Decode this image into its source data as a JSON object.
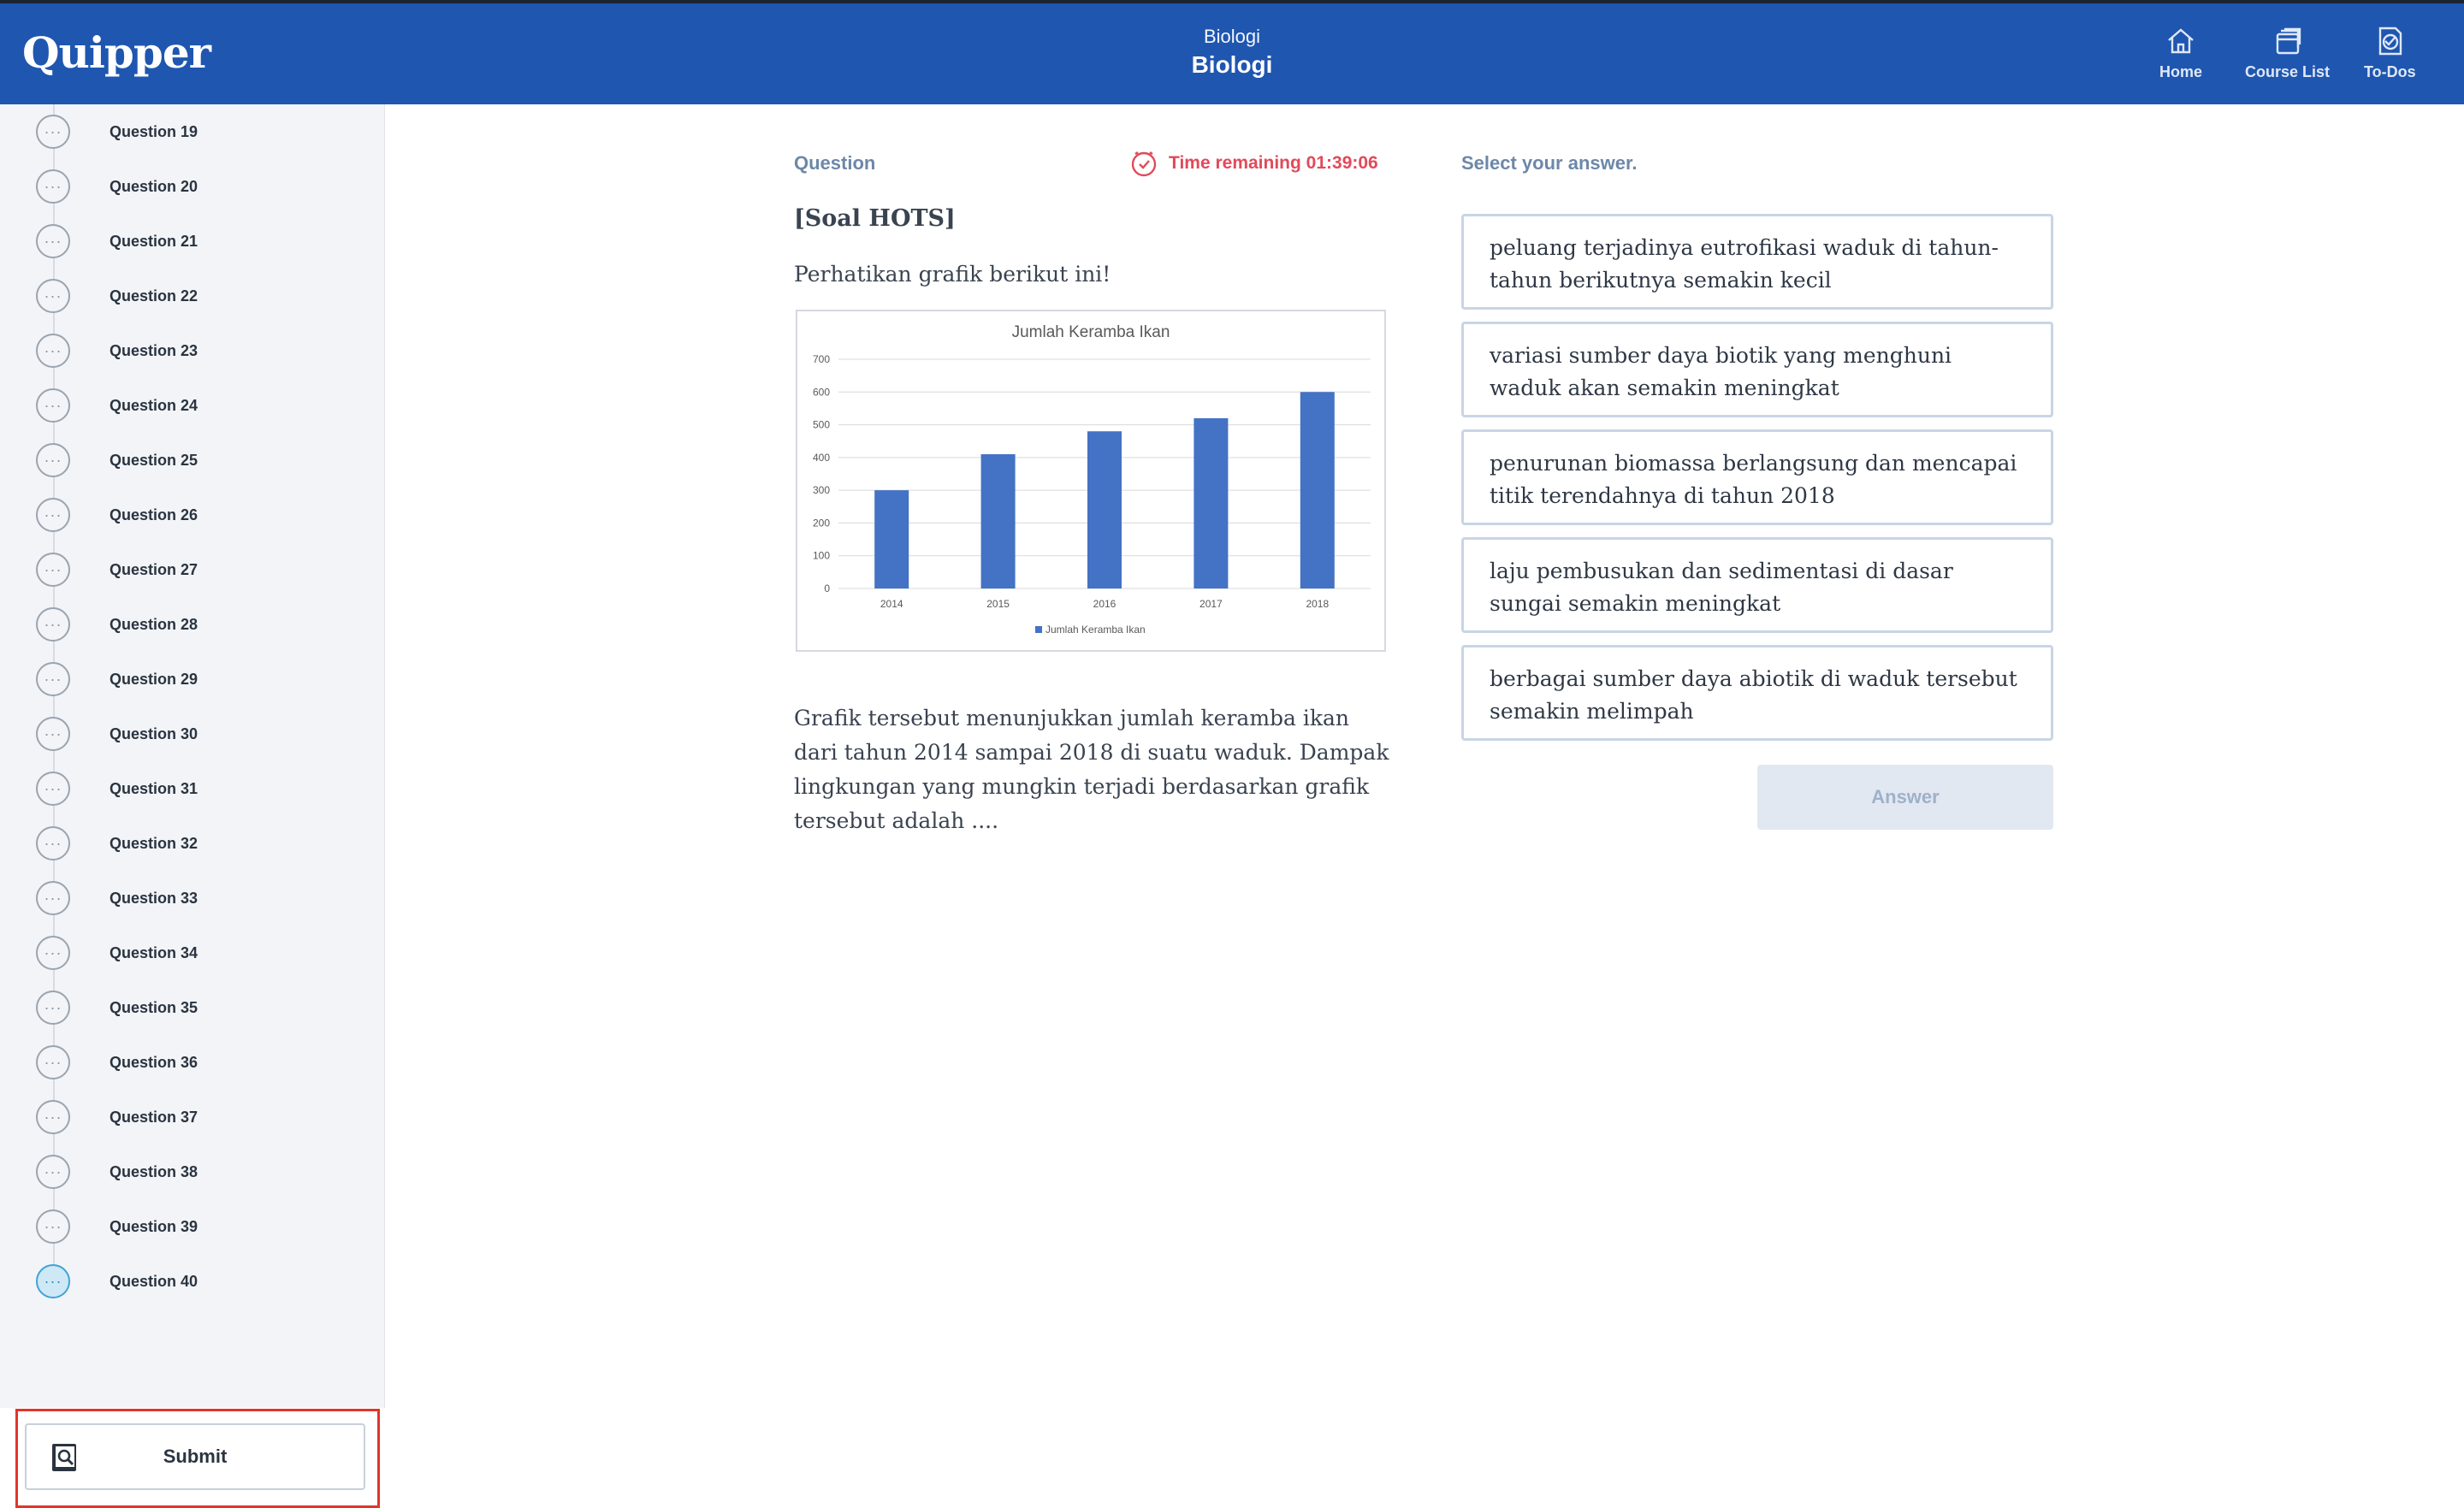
{
  "header": {
    "logo": "Quipper",
    "course_subtitle": "Biologi",
    "course_title": "Biologi",
    "nav": [
      {
        "label": "Home",
        "icon": "home-icon"
      },
      {
        "label": "Course List",
        "icon": "course-list-icon"
      },
      {
        "label": "To-Dos",
        "icon": "todos-icon"
      }
    ]
  },
  "sidebar": {
    "questions": [
      {
        "label": "Question 19",
        "status": "unanswered"
      },
      {
        "label": "Question 20",
        "status": "unanswered"
      },
      {
        "label": "Question 21",
        "status": "unanswered"
      },
      {
        "label": "Question 22",
        "status": "unanswered"
      },
      {
        "label": "Question 23",
        "status": "unanswered"
      },
      {
        "label": "Question 24",
        "status": "unanswered"
      },
      {
        "label": "Question 25",
        "status": "unanswered"
      },
      {
        "label": "Question 26",
        "status": "unanswered"
      },
      {
        "label": "Question 27",
        "status": "unanswered"
      },
      {
        "label": "Question 28",
        "status": "unanswered"
      },
      {
        "label": "Question 29",
        "status": "unanswered"
      },
      {
        "label": "Question 30",
        "status": "unanswered"
      },
      {
        "label": "Question 31",
        "status": "unanswered"
      },
      {
        "label": "Question 32",
        "status": "unanswered"
      },
      {
        "label": "Question 33",
        "status": "unanswered"
      },
      {
        "label": "Question 34",
        "status": "unanswered"
      },
      {
        "label": "Question 35",
        "status": "unanswered"
      },
      {
        "label": "Question 36",
        "status": "unanswered"
      },
      {
        "label": "Question 37",
        "status": "unanswered"
      },
      {
        "label": "Question 38",
        "status": "unanswered"
      },
      {
        "label": "Question 39",
        "status": "unanswered"
      },
      {
        "label": "Question 40",
        "status": "current"
      }
    ],
    "dots": "···",
    "submit_label": "Submit"
  },
  "question": {
    "heading": "Question",
    "timer": "Time remaining 01:39:06",
    "tag": "[Soal HOTS]",
    "intro": "Perhatikan grafik berikut ini!",
    "body": "Grafik tersebut menunjukkan jumlah keramba ikan dari tahun 2014 sampai 2018 di suatu waduk. Dampak lingkungan yang mungkin terjadi berdasarkan grafik tersebut adalah ...."
  },
  "chart_data": {
    "type": "bar",
    "title": "Jumlah Keramba Ikan",
    "categories": [
      "2014",
      "2015",
      "2016",
      "2017",
      "2018"
    ],
    "series": [
      {
        "name": "Jumlah Keramba Ikan",
        "values": [
          300,
          410,
          480,
          520,
          600
        ]
      }
    ],
    "ylim": [
      0,
      700
    ],
    "yticks": [
      0,
      100,
      200,
      300,
      400,
      500,
      600,
      700
    ],
    "grid": true,
    "legend": "bottom",
    "bar_color": "#4472c4"
  },
  "answers": {
    "heading": "Select your answer.",
    "options": [
      "peluang terjadinya eutrofikasi waduk di tahun-tahun berikutnya semakin kecil",
      "variasi sumber daya biotik yang menghuni waduk akan semakin meningkat",
      "penurunan biomassa berlangsung dan mencapai titik terendahnya di tahun 2018",
      "laju pembusukan dan sedimentasi di dasar sungai semakin meningkat",
      "berbagai sumber daya abiotik di waduk tersebut semakin melimpah"
    ],
    "button_label": "Answer"
  },
  "colors": {
    "header_bg": "#1f56b0",
    "timer": "#e14a5a",
    "submit_highlight": "#e0352b"
  }
}
